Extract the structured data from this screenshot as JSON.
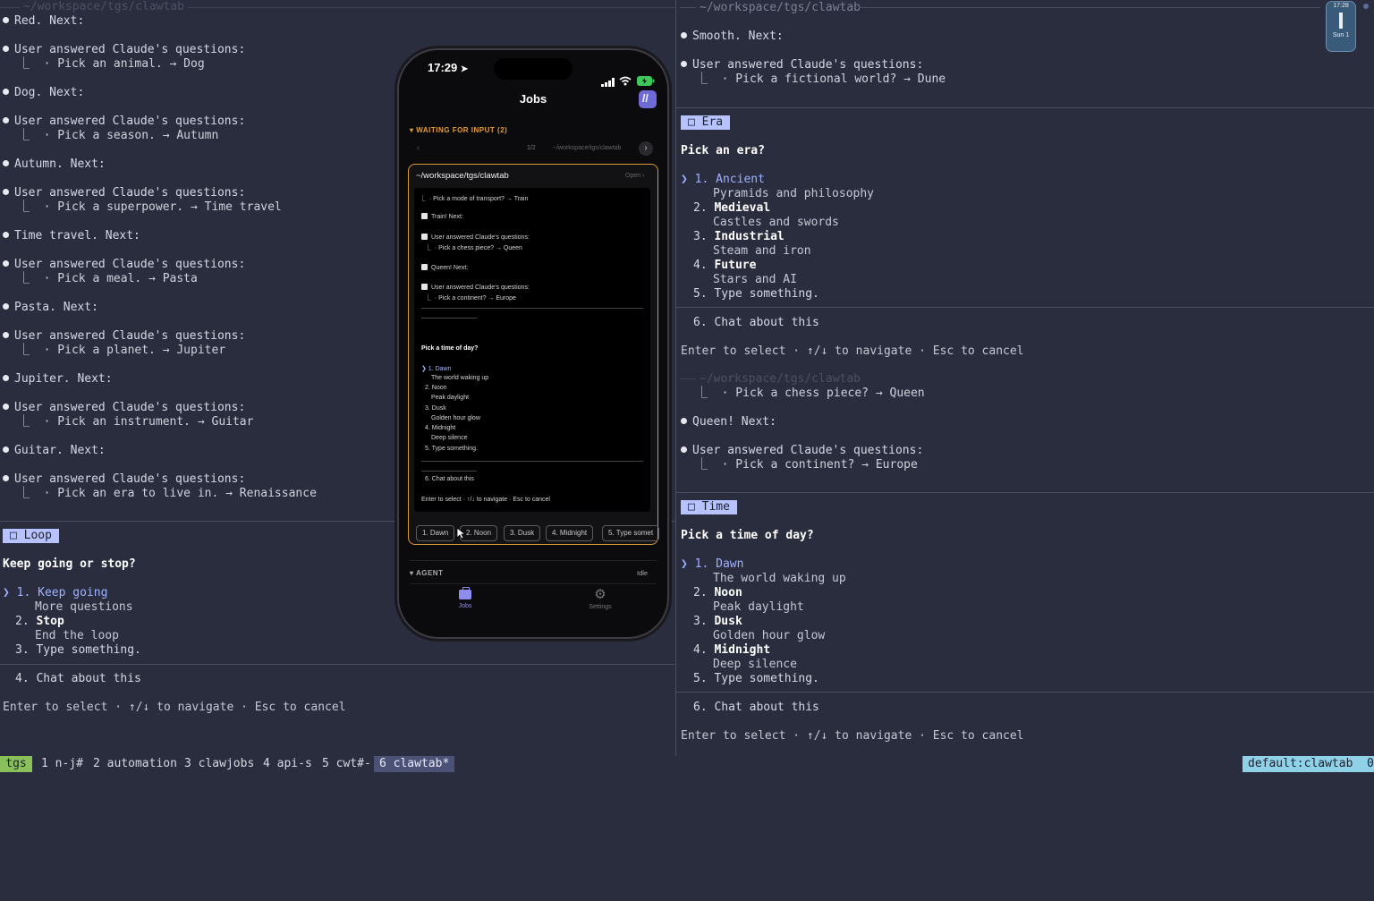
{
  "left_pane": {
    "entries": [
      {
        "type": "next",
        "text": "Red. Next:"
      },
      {
        "type": "answer",
        "header": "User answered Claude's questions:",
        "detail": "⎿  · Pick an animal. → Dog"
      },
      {
        "type": "next",
        "text": "Dog. Next:"
      },
      {
        "type": "answer",
        "header": "User answered Claude's questions:",
        "detail": "⎿  · Pick a season. → Autumn"
      },
      {
        "type": "next",
        "text": "Autumn. Next:"
      },
      {
        "type": "answer",
        "header": "User answered Claude's questions:",
        "detail": "⎿  · Pick a superpower. → Time travel"
      },
      {
        "type": "next",
        "text": "Time travel. Next:"
      },
      {
        "type": "answer",
        "header": "User answered Claude's questions:",
        "detail": "⎿  · Pick a meal. → Pasta"
      },
      {
        "type": "next",
        "text": "Pasta. Next:"
      },
      {
        "type": "answer",
        "header": "User answered Claude's questions:",
        "detail": "⎿  · Pick a planet. → Jupiter"
      },
      {
        "type": "next",
        "text": "Jupiter. Next:"
      },
      {
        "type": "answer",
        "header": "User answered Claude's questions:",
        "detail": "⎿  · Pick an instrument. → Guitar"
      },
      {
        "type": "next",
        "text": "Guitar. Next:"
      },
      {
        "type": "answer",
        "header": "User answered Claude's questions:",
        "detail": "⎿  · Pick an era to live in. → Renaissance"
      }
    ],
    "tag": "Loop",
    "question": "Keep going or stop?",
    "options": [
      {
        "num": "1.",
        "label": "Keep going",
        "desc": "More questions"
      },
      {
        "num": "2.",
        "label": "Stop",
        "desc": "End the loop"
      },
      {
        "num": "3.",
        "label": "Type something.",
        "desc": ""
      }
    ],
    "chat": "4. Chat about this",
    "hint": "Enter to select · ↑/↓ to navigate · Esc to cancel",
    "cursor": "❯"
  },
  "right_top": {
    "title": "~/workspace/tgs/clawtab",
    "line1": "Smooth. Next:",
    "answer_header": "User answered Claude's questions:",
    "answer_detail": "⎿  · Pick a fictional world? → Dune",
    "tag": "Era",
    "question": "Pick an era?",
    "options": [
      {
        "num": "1.",
        "label": "Ancient",
        "desc": "Pyramids and philosophy"
      },
      {
        "num": "2.",
        "label": "Medieval",
        "desc": "Castles and swords"
      },
      {
        "num": "3.",
        "label": "Industrial",
        "desc": "Steam and iron"
      },
      {
        "num": "4.",
        "label": "Future",
        "desc": "Stars and AI"
      },
      {
        "num": "5.",
        "label": "Type something.",
        "desc": ""
      }
    ],
    "chat": "6. Chat about this",
    "hint": "Enter to select · ↑/↓ to navigate · Esc to cancel"
  },
  "right_bottom": {
    "title": "~/workspace/tgs/clawtab",
    "detail1": "⎿  · Pick a chess piece? → Queen",
    "line_next": "Queen! Next:",
    "answer_header": "User answered Claude's questions:",
    "answer_detail": "⎿  · Pick a continent? → Europe",
    "tag": "Time",
    "question": "Pick a time of day?",
    "options": [
      {
        "num": "1.",
        "label": "Dawn",
        "desc": "The world waking up"
      },
      {
        "num": "2.",
        "label": "Noon",
        "desc": "Peak daylight"
      },
      {
        "num": "3.",
        "label": "Dusk",
        "desc": "Golden hour glow"
      },
      {
        "num": "4.",
        "label": "Midnight",
        "desc": "Deep silence"
      },
      {
        "num": "5.",
        "label": "Type something.",
        "desc": ""
      }
    ],
    "chat": "6. Chat about this",
    "hint": "Enter to select · ↑/↓ to navigate · Esc to cancel"
  },
  "top_left_title": "~/workspace/tgs/clawtab",
  "phone": {
    "time": "17:29",
    "header": "Jobs",
    "section": "WAITING FOR INPUT (2)",
    "pager": "1/2",
    "pager_path": "~/workspace/tgs/clawtab",
    "card_title": "~/workspace/tgs/clawtab",
    "card_open": "Open ›",
    "term_lines": [
      "⎿  · Pick a mode of transport? → Train",
      "Train! Next:",
      "User answered Claude's questions:",
      "⎿  · Pick a chess piece? → Queen",
      "Queen! Next:",
      "User answered Claude's questions:",
      "⎿  · Pick a continent? → Europe"
    ],
    "question": "Pick a time of day?",
    "options": [
      "❯ 1. Dawn",
      "The world waking up",
      "2. Noon",
      "Peak daylight",
      "3. Dusk",
      "Golden hour glow",
      "4. Midnight",
      "Deep silence",
      "5. Type something."
    ],
    "chat": "6. Chat about this",
    "hint": "Enter to select · ↑/↓ to navigate · Esc to cancel",
    "chips": [
      "1. Dawn",
      "2. Noon",
      "3. Dusk",
      "4. Midnight",
      "5. Type somet"
    ],
    "agent": "AGENT",
    "agent_status": "Idle",
    "tab_jobs": "Jobs",
    "tab_settings": "Settings"
  },
  "corner_widget": {
    "time": "17:28",
    "sub": "Sun 1"
  },
  "statusbar": {
    "session": "tgs",
    "windows": [
      "1 n-j#",
      "2 automation",
      "3 clawjobs",
      "4 api-s",
      "5 cwt#-",
      "6 clawtab*"
    ],
    "right": "default:clawtab  0"
  }
}
